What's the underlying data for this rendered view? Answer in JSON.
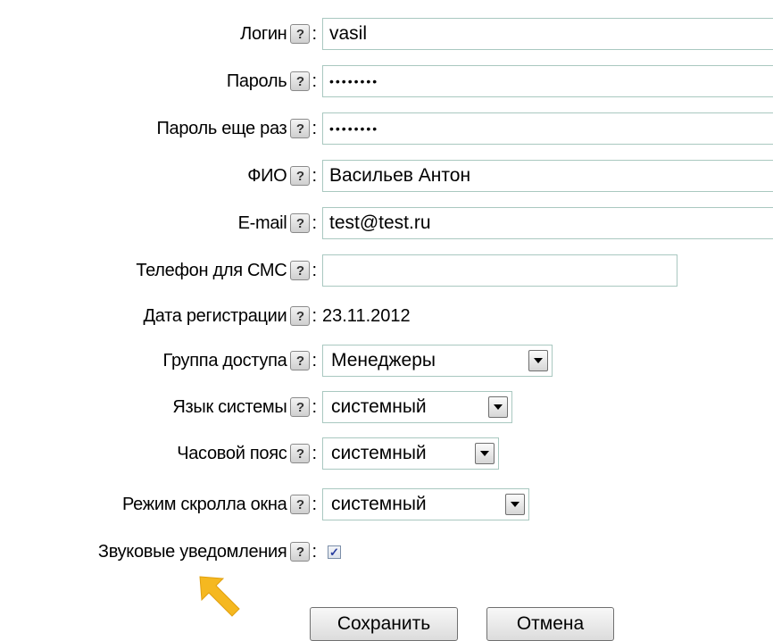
{
  "help_symbol": "?",
  "colon": ":",
  "fields": {
    "login": {
      "label": "Логин",
      "value": "vasil"
    },
    "password": {
      "label": "Пароль",
      "value": "••••••••"
    },
    "password_repeat": {
      "label": "Пароль еще раз",
      "value": "••••••••"
    },
    "full_name": {
      "label": "ФИО",
      "value": "Васильев Антон"
    },
    "email": {
      "label": "E-mail",
      "value": "test@test.ru"
    },
    "sms_phone": {
      "label": "Телефон для СМС",
      "value": ""
    },
    "registration_date": {
      "label": "Дата регистрации",
      "value": "23.11.2012"
    },
    "access_group": {
      "label": "Группа доступа",
      "selected": "Менеджеры"
    },
    "system_language": {
      "label": "Язык системы",
      "selected": "системный"
    },
    "time_zone": {
      "label": "Часовой пояс",
      "selected": "системный"
    },
    "window_scroll_mode": {
      "label": "Режим скролла окна",
      "selected": "системный"
    },
    "sound_notifications": {
      "label": "Звуковые уведомления",
      "checked": true,
      "check_mark": "✓"
    }
  },
  "buttons": {
    "save": "Сохранить",
    "cancel": "Отмена"
  },
  "colors": {
    "input_border": "#a9c8c0",
    "pointer_arrow": "#f5b820"
  },
  "icons": {
    "help": "help-icon",
    "dropdown": "chevron-down-icon",
    "pointer": "pointer-arrow-icon"
  }
}
